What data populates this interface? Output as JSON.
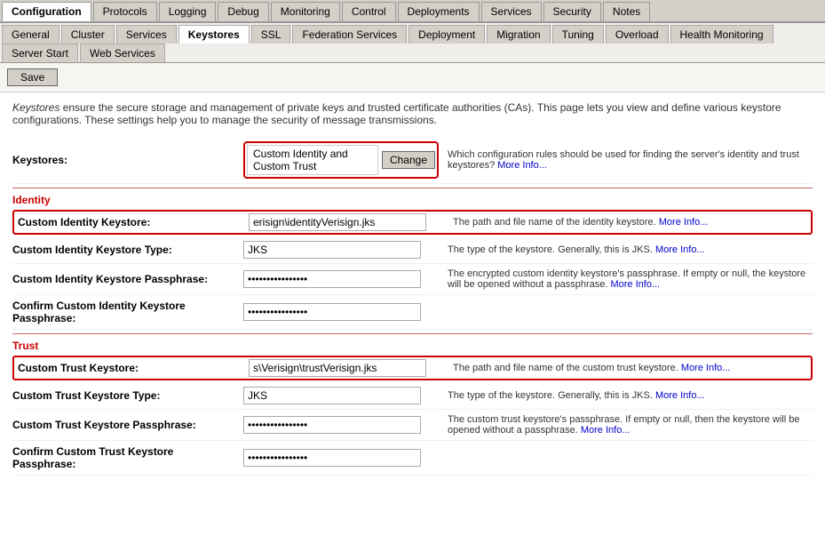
{
  "tabs1": {
    "items": [
      {
        "label": "Configuration",
        "active": true
      },
      {
        "label": "Protocols",
        "active": false
      },
      {
        "label": "Logging",
        "active": false
      },
      {
        "label": "Debug",
        "active": false
      },
      {
        "label": "Monitoring",
        "active": false
      },
      {
        "label": "Control",
        "active": false
      },
      {
        "label": "Deployments",
        "active": false
      },
      {
        "label": "Services",
        "active": false
      },
      {
        "label": "Security",
        "active": false
      },
      {
        "label": "Notes",
        "active": false
      }
    ]
  },
  "tabs2": {
    "items": [
      {
        "label": "General",
        "active": false
      },
      {
        "label": "Cluster",
        "active": false
      },
      {
        "label": "Services",
        "active": false
      },
      {
        "label": "Keystores",
        "active": true
      },
      {
        "label": "SSL",
        "active": false
      },
      {
        "label": "Federation Services",
        "active": false
      },
      {
        "label": "Deployment",
        "active": false
      },
      {
        "label": "Migration",
        "active": false
      },
      {
        "label": "Tuning",
        "active": false
      },
      {
        "label": "Overload",
        "active": false
      },
      {
        "label": "Health Monitoring",
        "active": false
      },
      {
        "label": "Server Start",
        "active": false
      },
      {
        "label": "Web Services",
        "active": false
      }
    ]
  },
  "toolbar": {
    "save_label": "Save"
  },
  "description": "Keystores ensure the secure storage and management of private keys and trusted certificate authorities (CAs). This page lets you view and define various keystore configurations. These settings help you to manage the security of message transmissions.",
  "keystores_row": {
    "label": "Keystores:",
    "value": "Custom Identity and Custom Trust",
    "change_btn": "Change",
    "help": "Which configuration rules should be used for finding the server's identity and trust keystores?",
    "more_info": "More Info..."
  },
  "identity_section": {
    "header": "Identity",
    "fields": [
      {
        "label": "Custom Identity Keystore:",
        "value": "erisign\\identityVerisign.jks",
        "type": "text",
        "highlighted": true,
        "help": "The path and file name of the identity keystore.",
        "more_info": "More Info..."
      },
      {
        "label": "Custom Identity Keystore Type:",
        "value": "JKS",
        "type": "text",
        "highlighted": false,
        "help": "The type of the keystore. Generally, this is JKS.",
        "more_info": "More Info..."
      },
      {
        "label": "Custom Identity Keystore Passphrase:",
        "value": "••••••••••••••••",
        "type": "password",
        "highlighted": false,
        "help": "The encrypted custom identity keystore's passphrase. If empty or null, the keystore will be opened without a passphrase.",
        "more_info": "More Info..."
      },
      {
        "label": "Confirm Custom Identity Keystore Passphrase:",
        "value": "••••••••••••••••",
        "type": "password",
        "highlighted": false,
        "help": "",
        "more_info": ""
      }
    ]
  },
  "trust_section": {
    "header": "Trust",
    "fields": [
      {
        "label": "Custom Trust Keystore:",
        "value": "s\\Verisign\\trustVerisign.jks",
        "type": "text",
        "highlighted": true,
        "help": "The path and file name of the custom trust keystore.",
        "more_info": "More Info..."
      },
      {
        "label": "Custom Trust Keystore Type:",
        "value": "JKS",
        "type": "text",
        "highlighted": false,
        "help": "The type of the keystore. Generally, this is JKS.",
        "more_info": "More Info..."
      },
      {
        "label": "Custom Trust Keystore Passphrase:",
        "value": "••••••••••••••••",
        "type": "password",
        "highlighted": false,
        "help": "The custom trust keystore's passphrase. If empty or null, then the keystore will be opened without a passphrase.",
        "more_info": "More Info..."
      },
      {
        "label": "Confirm Custom Trust Keystore Passphrase:",
        "value": "••••••••••••••••",
        "type": "password",
        "highlighted": false,
        "help": "",
        "more_info": ""
      }
    ]
  }
}
